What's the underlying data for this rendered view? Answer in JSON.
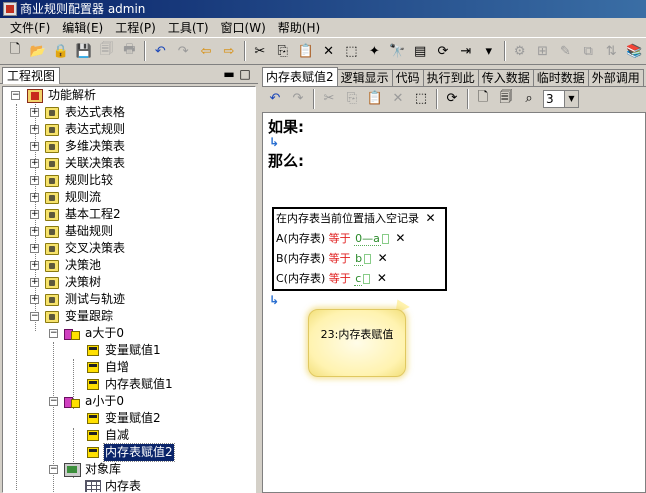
{
  "window": {
    "title": "商业规则配置器 admin"
  },
  "menubar": {
    "items": [
      "文件(F)",
      "编辑(E)",
      "工程(P)",
      "工具(T)",
      "窗口(W)",
      "帮助(H)"
    ]
  },
  "left_panel": {
    "title": "工程视图",
    "pin_glyph": "▬",
    "close_glyph": "□"
  },
  "tree": {
    "root": "功能解析",
    "items": [
      "表达式表格",
      "表达式规则",
      "多维决策表",
      "关联决策表",
      "规则比较",
      "规则流",
      "基本工程2",
      "基础规则",
      "交叉决策表",
      "决策池",
      "决策树",
      "测试与轨迹",
      "变量跟踪"
    ],
    "group1": {
      "label": "a大于0",
      "children": [
        "变量赋值1",
        "自增",
        "内存表赋值1"
      ]
    },
    "group2": {
      "label": "a小于0",
      "children": [
        "变量赋值2",
        "自减",
        "内存表赋值2"
      ]
    },
    "objects": {
      "label": "对象库",
      "children": [
        "内存表"
      ]
    }
  },
  "tabs": [
    "内存表赋值2",
    "逻辑显示",
    "代码",
    "执行到此",
    "传入数据",
    "临时数据",
    "外部调用"
  ],
  "editor_toolbar": {
    "zoom_value": "3"
  },
  "rule": {
    "if_label": "如果:",
    "then_label": "那么:",
    "insert_text": "在内存表当前位置插入空记录",
    "rows": [
      {
        "field": "A(内存表)",
        "op": "等于",
        "expr": "0—a"
      },
      {
        "field": "B(内存表)",
        "op": "等于",
        "expr": "b"
      },
      {
        "field": "C(内存表)",
        "op": "等于",
        "expr": "c"
      }
    ],
    "remove_glyph": "✕",
    "callout": "23:内存表赋值"
  }
}
